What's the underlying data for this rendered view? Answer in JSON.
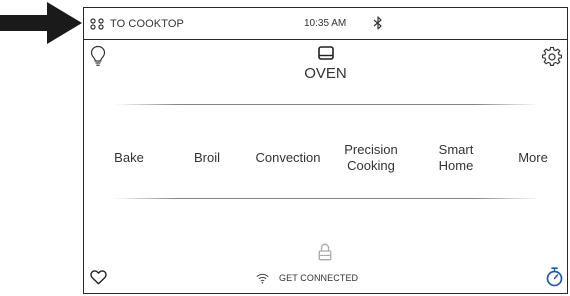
{
  "colors": {
    "text": "#333333",
    "border": "#2a2a2a",
    "accent_blue": "#1f57b8",
    "divider": "#787878",
    "background": "#ffffff"
  },
  "annotation": {
    "icon": "right-arrow-pointer-icon"
  },
  "status_bar": {
    "cooktop_icon": "cooktop-burners-icon",
    "cooktop_label": "TO COOKTOP",
    "time": "10:35 AM",
    "bluetooth_icon": "bluetooth-icon"
  },
  "header": {
    "light_icon": "light-bulb-icon",
    "oven_icon": "oven-icon",
    "title": "OVEN",
    "settings_icon": "gear-icon"
  },
  "modes": [
    {
      "label": "Bake"
    },
    {
      "label": "Broil"
    },
    {
      "label": "Convection"
    },
    {
      "label": "Precision\nCooking"
    },
    {
      "label": "Smart\nHome"
    },
    {
      "label": "More"
    }
  ],
  "footer": {
    "lock_icon": "lock-icon",
    "favorites_icon": "heart-icon",
    "wifi_icon": "wifi-icon",
    "connect_label": "GET CONNECTED",
    "timer_icon": "timer-icon"
  }
}
